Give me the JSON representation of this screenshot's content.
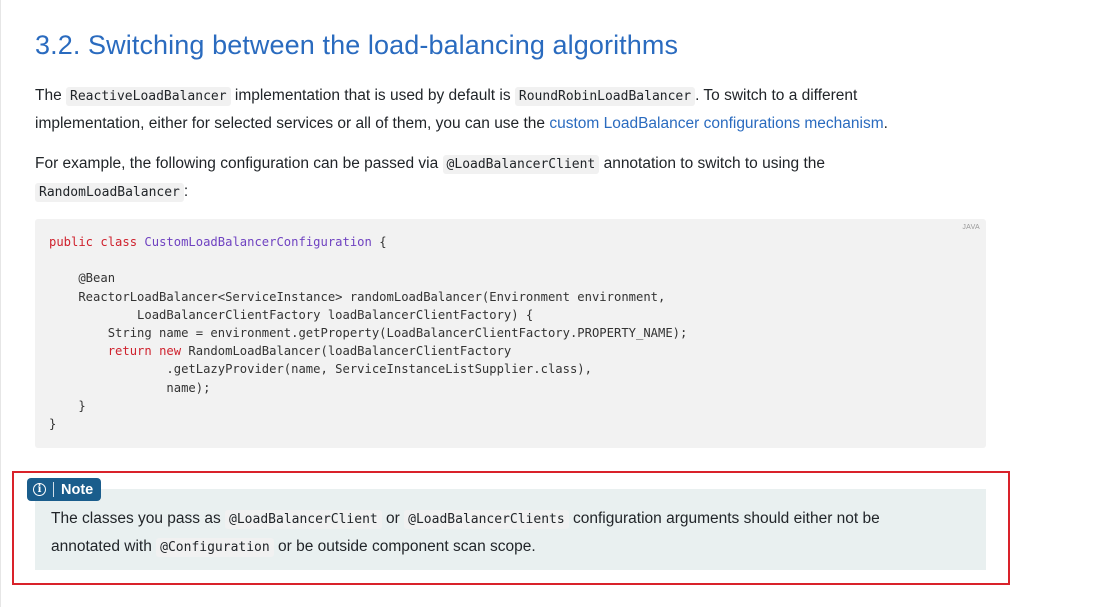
{
  "title": "3.2. Switching between the load-balancing algorithms",
  "p1": {
    "t1": "The ",
    "c1": "ReactiveLoadBalancer",
    "t2": " implementation that is used by default is ",
    "c2": "RoundRobinLoadBalancer",
    "t3": ". To switch to a different implementation, either for selected services or all of them, you can use the ",
    "link": "custom LoadBalancer configurations mechanism",
    "t4": "."
  },
  "p2": {
    "t1": "For example, the following configuration can be passed via ",
    "c1": "@LoadBalancerClient",
    "t2": " annotation to switch to using the ",
    "c2": "RandomLoadBalancer",
    "t3": ":"
  },
  "code": {
    "lang": "JAVA",
    "l1_kw": "public class ",
    "l1_cls": "CustomLoadBalancerConfiguration",
    "l1_rest": " {",
    "l3": "    @Bean",
    "l4": "    ReactorLoadBalancer<ServiceInstance> randomLoadBalancer(Environment environment,",
    "l5": "            LoadBalancerClientFactory loadBalancerClientFactory) {",
    "l6": "        String name = environment.getProperty(LoadBalancerClientFactory.PROPERTY_NAME);",
    "l7_indent": "        ",
    "l7_kw": "return new ",
    "l7_rest": "RandomLoadBalancer(loadBalancerClientFactory",
    "l8": "                .getLazyProvider(name, ServiceInstanceListSupplier.class),",
    "l9": "                name);",
    "l10": "    }",
    "l11": "}"
  },
  "note": {
    "icon": "info-icon",
    "label": "Note",
    "t1": "The classes you pass as ",
    "c1": "@LoadBalancerClient",
    "t2": " or ",
    "c2": "@LoadBalancerClients",
    "t3": " configuration arguments should either not be annotated with ",
    "c3": "@Configuration",
    "t4": " or be outside component scan scope."
  },
  "colors": {
    "heading": "#2a6bbf",
    "link": "#2a6bbf",
    "note_badge": "#1a5d8c",
    "note_background": "#e9f0f0",
    "highlight_border": "#d9222a",
    "code_background": "#f2f2f2"
  }
}
